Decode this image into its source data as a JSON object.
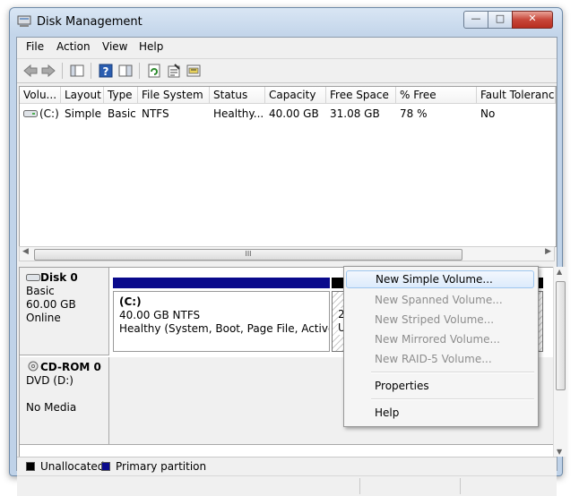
{
  "window": {
    "title": "Disk Management"
  },
  "menu": [
    "File",
    "Action",
    "View",
    "Help"
  ],
  "toolbar": {
    "icons": [
      "back-icon",
      "forward-icon",
      "console-tree-icon",
      "help-icon",
      "show-pane-icon",
      "refresh-icon",
      "properties-icon",
      "rescan-icon"
    ]
  },
  "volume_list": {
    "columns": [
      "Volu...",
      "Layout",
      "Type",
      "File System",
      "Status",
      "Capacity",
      "Free Space",
      "% Free",
      "Fault Tolerance"
    ],
    "rows": [
      {
        "volume": "(C:)",
        "layout": "Simple",
        "type": "Basic",
        "fs": "NTFS",
        "status": "Healthy...",
        "capacity": "40.00 GB",
        "free": "31.08 GB",
        "pct": "78 %",
        "fault": "No"
      }
    ],
    "scroll_grip": "III"
  },
  "disks": [
    {
      "name": "Disk 0",
      "type": "Basic",
      "size": "60.00 GB",
      "state": "Online"
    },
    {
      "name": "CD-ROM 0",
      "type": "DVD (D:)",
      "size": "",
      "state": "No Media"
    }
  ],
  "partition_c": {
    "label": "(C:)",
    "size_fs": "40.00 GB NTFS",
    "status": "Healthy (System, Boot, Page File, Active, Cra"
  },
  "partition_unalloc": {
    "line1": "2",
    "line2": "U"
  },
  "context_menu": {
    "items": [
      {
        "label": "New Simple Volume...",
        "enabled": true
      },
      {
        "label": "New Spanned Volume...",
        "enabled": false
      },
      {
        "label": "New Striped Volume...",
        "enabled": false
      },
      {
        "label": "New Mirrored Volume...",
        "enabled": false
      },
      {
        "label": "New RAID-5 Volume...",
        "enabled": false
      },
      {
        "label": "Properties",
        "enabled": true
      },
      {
        "label": "Help",
        "enabled": true
      }
    ]
  },
  "legend": [
    {
      "label": "Unallocated",
      "color": "#000000"
    },
    {
      "label": "Primary partition",
      "color": "#0a0a8c"
    }
  ],
  "colors": {
    "primary": "#0a0a8c",
    "unallocated": "#000000"
  }
}
